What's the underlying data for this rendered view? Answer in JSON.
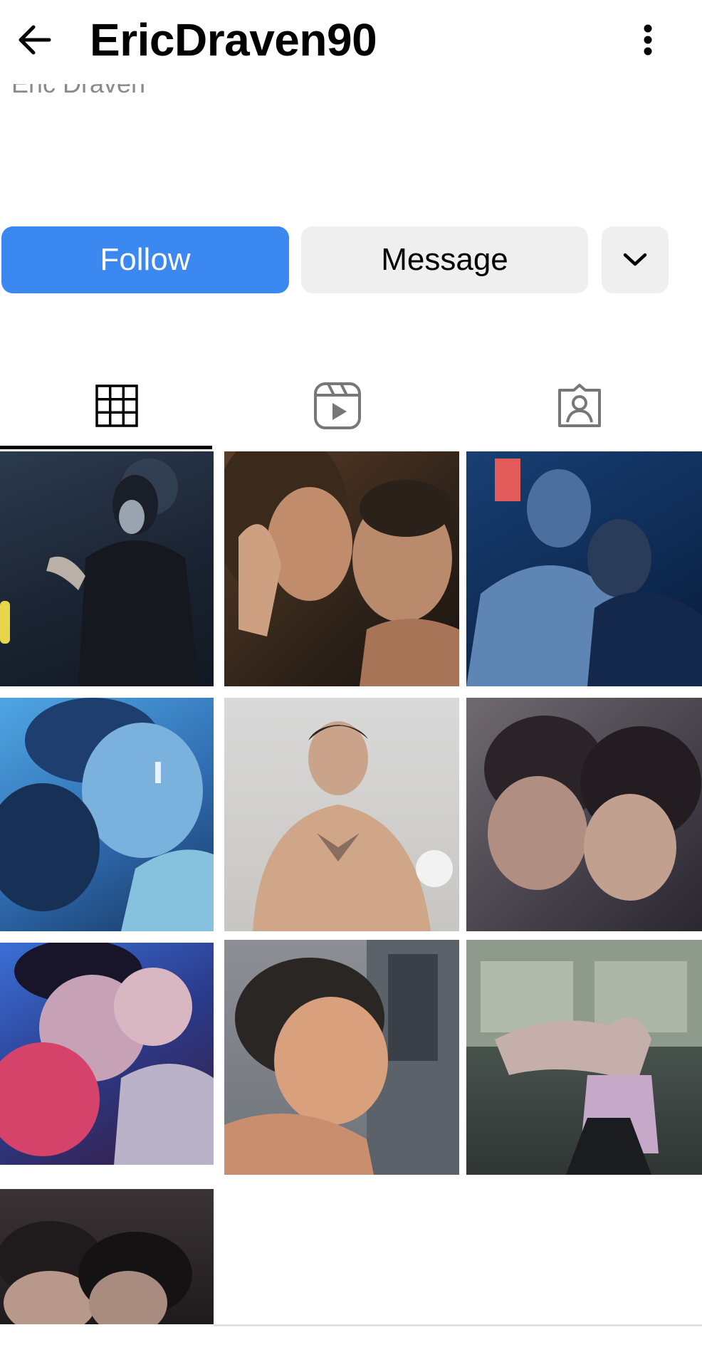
{
  "header": {
    "username": "EricDraven90",
    "back_icon": "arrow-left-icon",
    "more_icon": "more-vertical-icon"
  },
  "profile": {
    "cutoff_name": "Eric Draven"
  },
  "actions": {
    "follow_label": "Follow",
    "message_label": "Message",
    "dropdown_icon": "chevron-down-icon",
    "follow_color": "#3b89f0",
    "secondary_color": "#efefef"
  },
  "tabs": [
    {
      "name": "posts-grid",
      "icon": "grid-icon",
      "selected": true
    },
    {
      "name": "reels",
      "icon": "reels-icon",
      "selected": false
    },
    {
      "name": "tagged",
      "icon": "tagged-user-icon",
      "selected": false
    }
  ],
  "posts": [
    {
      "theme": "dark blue room, person in hood"
    },
    {
      "theme": "warm toned kiss"
    },
    {
      "theme": "blue toned embrace"
    },
    {
      "theme": "blue neon kiss"
    },
    {
      "theme": "shirtless tattooed man portrait"
    },
    {
      "theme": "grey toned kiss"
    },
    {
      "theme": "red and blue neon couple"
    },
    {
      "theme": "mullet profile against window"
    },
    {
      "theme": "shirtless man at window"
    },
    {
      "theme": "dark close-up faces"
    }
  ]
}
